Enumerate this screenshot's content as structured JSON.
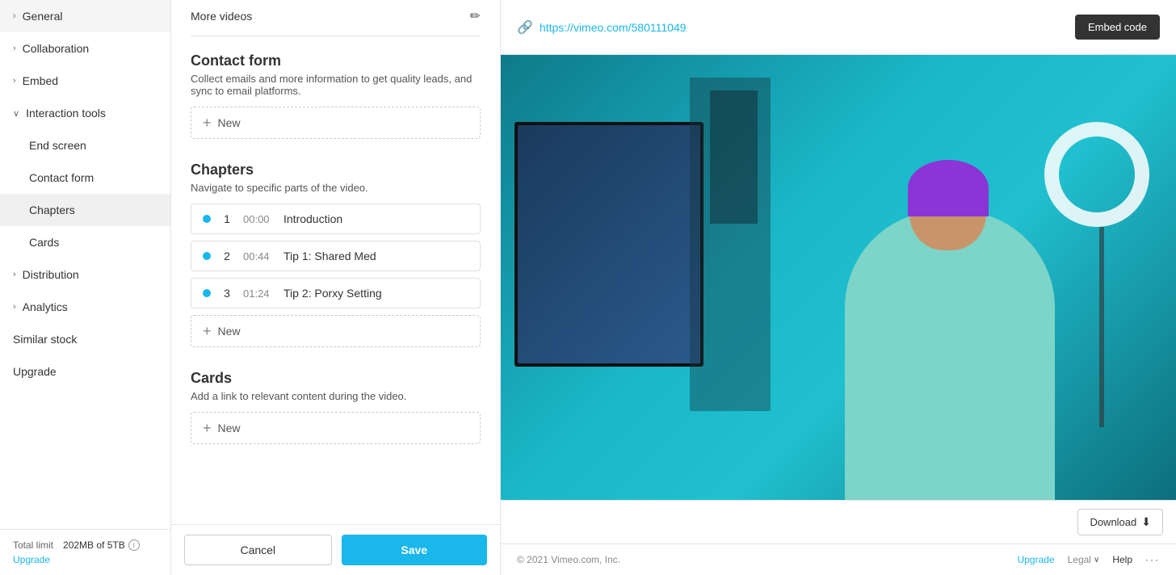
{
  "sidebar": {
    "items": [
      {
        "id": "general",
        "label": "General",
        "level": "top",
        "expandable": true
      },
      {
        "id": "collaboration",
        "label": "Collaboration",
        "level": "top",
        "expandable": true
      },
      {
        "id": "embed",
        "label": "Embed",
        "level": "top",
        "expandable": true
      },
      {
        "id": "interaction-tools",
        "label": "Interaction tools",
        "level": "top",
        "expandable": true,
        "expanded": true
      },
      {
        "id": "end-screen",
        "label": "End screen",
        "level": "sub"
      },
      {
        "id": "contact-form",
        "label": "Contact form",
        "level": "sub"
      },
      {
        "id": "chapters",
        "label": "Chapters",
        "level": "sub",
        "active": true
      },
      {
        "id": "cards",
        "label": "Cards",
        "level": "sub"
      },
      {
        "id": "distribution",
        "label": "Distribution",
        "level": "top",
        "expandable": true
      },
      {
        "id": "analytics",
        "label": "Analytics",
        "level": "top",
        "expandable": true
      },
      {
        "id": "similar-stock",
        "label": "Similar stock",
        "level": "top"
      },
      {
        "id": "upgrade",
        "label": "Upgrade",
        "level": "top"
      }
    ],
    "total_limit_label": "Total limit",
    "storage_used": "202MB of 5TB",
    "upgrade_link": "Upgrade"
  },
  "middle": {
    "more_videos_label": "More videos",
    "contact_form": {
      "title": "Contact form",
      "description": "Collect emails and more information to get quality leads, and sync to email platforms.",
      "add_new_label": "New"
    },
    "chapters": {
      "title": "Chapters",
      "description": "Navigate to specific parts of the video.",
      "items": [
        {
          "num": "1",
          "time": "00:00",
          "name": "Introduction"
        },
        {
          "num": "2",
          "time": "00:44",
          "name": "Tip 1: Shared Med"
        },
        {
          "num": "3",
          "time": "01:24",
          "name": "Tip 2: Porxy Setting"
        }
      ],
      "add_new_label": "New"
    },
    "cards": {
      "title": "Cards",
      "description": "Add a link to relevant content during the video.",
      "add_new_label": "New"
    },
    "footer": {
      "cancel_label": "Cancel",
      "save_label": "Save"
    }
  },
  "right": {
    "video_url": "https://vimeo.com/580111049",
    "embed_code_label": "Embed code",
    "download_label": "Download",
    "footer": {
      "copyright": "© 2021 Vimeo.com, Inc.",
      "upgrade_label": "Upgrade",
      "legal_label": "Legal",
      "help_label": "Help"
    }
  }
}
